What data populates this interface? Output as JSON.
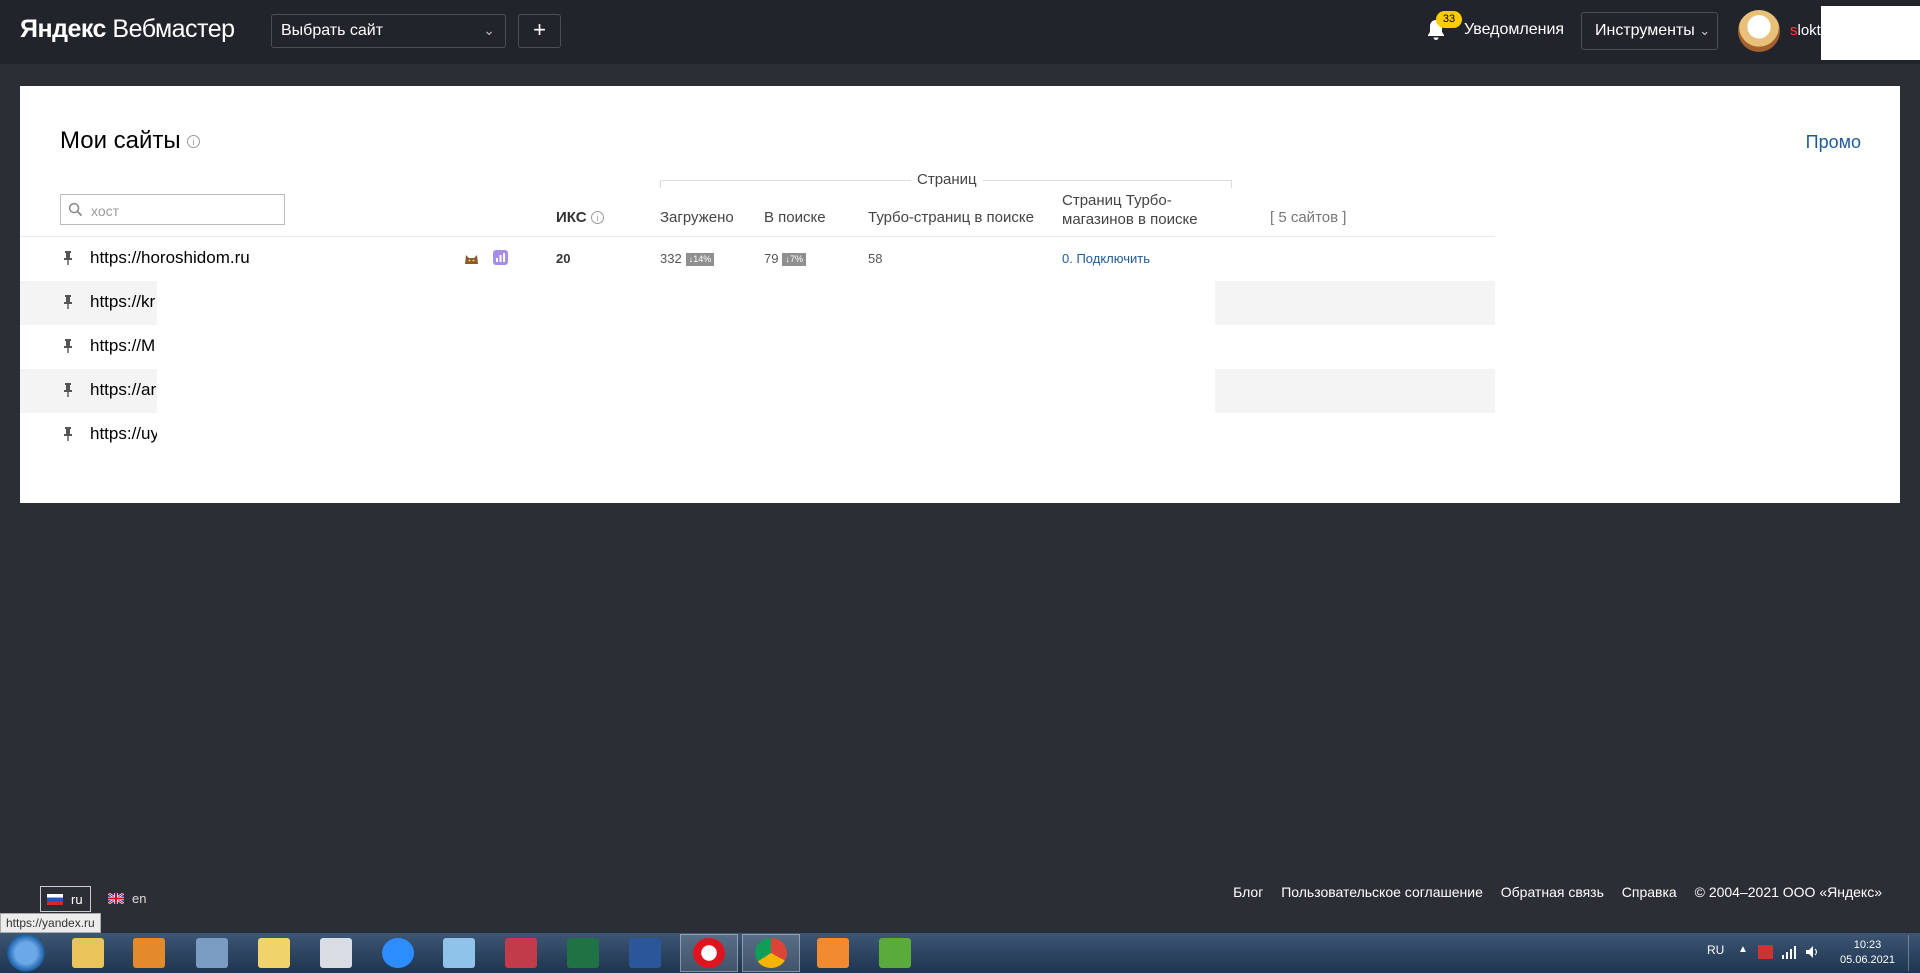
{
  "header": {
    "logo_brand": "Яндекс",
    "logo_product": "Вебмастер",
    "site_select_label": "Выбрать сайт",
    "add_label": "+",
    "notifications_count": "33",
    "notifications_label": "Уведомления",
    "tools_label": "Инструменты",
    "username_first_letter": "s",
    "username_rest": "lokt"
  },
  "main": {
    "title": "Мои сайты",
    "info_glyph": "i",
    "promo_label": "Промо",
    "search_placeholder": "хост",
    "columns": {
      "iks": "ИКС",
      "pages_group": "Страниц",
      "loaded": "Загружено",
      "in_search": "В поиске",
      "turbo_in_search": "Турбо-страниц в поиске",
      "turbo_shops_in_search": "Страниц Турбо-магазинов в поиске",
      "sites_count": "[ 5 сайтов ]"
    },
    "rows": [
      {
        "url": "https://horoshidom.ru",
        "iks": "20",
        "loaded": "332",
        "loaded_delta": "↓14%",
        "in_search": "79",
        "in_search_delta": "↓7%",
        "turbo": "58",
        "turbo_shop": "0. Подключить"
      },
      {
        "url": "https://kr"
      },
      {
        "url": "https://M"
      },
      {
        "url": "https://ar"
      },
      {
        "url": "https://uy"
      }
    ]
  },
  "footer": {
    "lang_ru": "ru",
    "lang_en": "en",
    "links": [
      "Блог",
      "Пользовательское соглашение",
      "Обратная связь",
      "Справка"
    ],
    "copyright": "© 2004–2021 ООО «Яндекс»"
  },
  "status_bar_url": "https://yandex.ru",
  "taskbar": {
    "tray_lang": "RU",
    "time": "10:23",
    "date": "05.06.2021"
  },
  "colors": {
    "page_bg": "#2b2f35",
    "header_bg": "#21252b",
    "link_blue": "#1f5a99",
    "badge_yellow": "#ffcc00"
  }
}
